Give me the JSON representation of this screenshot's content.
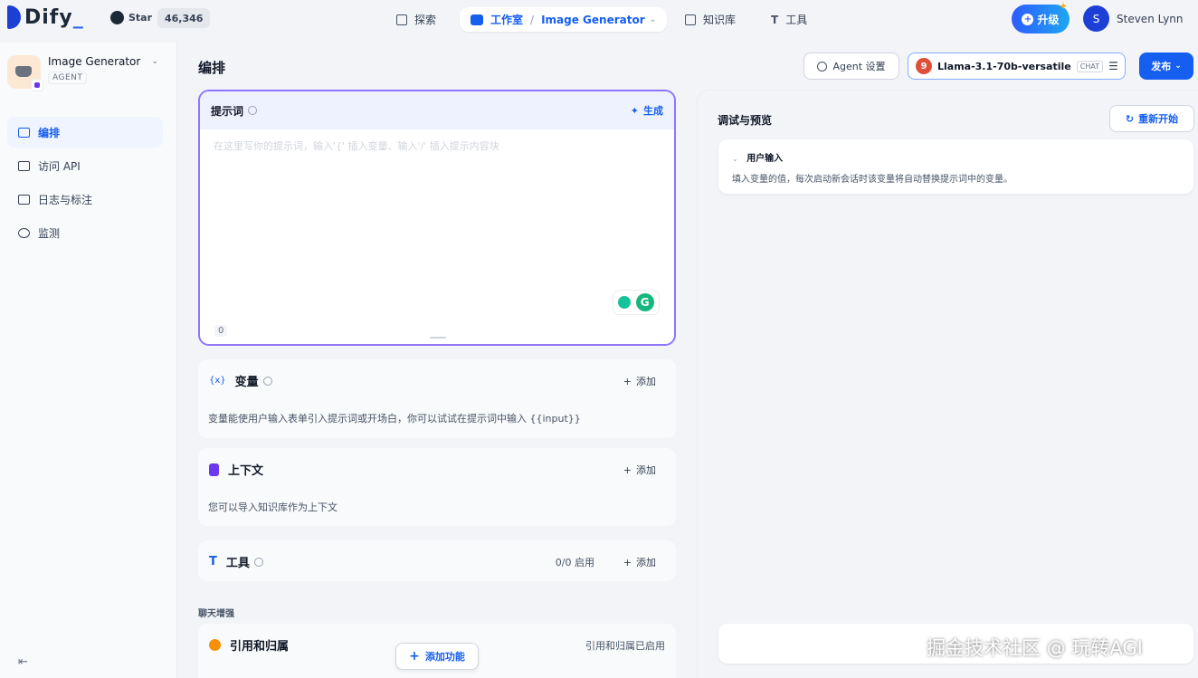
{
  "header": {
    "logo": "Dify",
    "github_label": "Star",
    "github_count": "46,346",
    "nav_explore": "探索",
    "nav_studio": "工作室",
    "nav_separator": "/",
    "nav_app": "Image Generator",
    "nav_knowledge": "知识库",
    "nav_tools": "工具",
    "upgrade": "升级",
    "user_initial": "S",
    "user_name": "Steven Lynn"
  },
  "sidebar": {
    "app_name": "Image Generator",
    "app_type": "AGENT",
    "items": [
      {
        "label": "编排",
        "active": true
      },
      {
        "label": "访问 API",
        "active": false
      },
      {
        "label": "日志与标注",
        "active": false
      },
      {
        "label": "监测",
        "active": false
      }
    ]
  },
  "main": {
    "title": "编排",
    "agent_settings": "Agent 设置",
    "model_badge": "9",
    "model_name": "Llama-3.1-70b-versatile",
    "model_tag": "CHAT",
    "publish": "发布",
    "prompt": {
      "title": "提示词",
      "generate": "生成",
      "placeholder": "在这里写你的提示词，输入'{' 插入变量、输入'/' 插入提示内容块",
      "count": "0"
    },
    "variables": {
      "icon": "{x}",
      "title": "变量",
      "add": "添加",
      "desc": "变量能使用户输入表单引入提示词或开场白，你可以试试在提示词中输入 {{input}}"
    },
    "context": {
      "title": "上下文",
      "add": "添加",
      "desc": "您可以导入知识库作为上下文"
    },
    "tools": {
      "title": "工具",
      "status": "0/0 启用",
      "add": "添加"
    },
    "chat_enhance": "聊天增强",
    "citation": {
      "title": "引用和归属",
      "status": "引用和归属已启用"
    },
    "add_feature": "添加功能"
  },
  "preview": {
    "title": "调试与预览",
    "restart": "重新开始",
    "user_input_title": "用户输入",
    "user_input_desc": "填入变量的值，每次启动新会话时该变量将自动替换提示词中的变量。"
  },
  "watermark": "掘金技术社区 @ 玩转AGI",
  "colors": {
    "primary": "#155eef",
    "prompt_border": "#8f75ff",
    "background": "#f2f4f7"
  }
}
